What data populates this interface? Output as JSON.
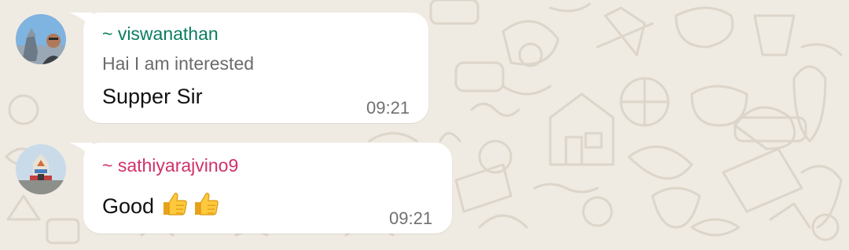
{
  "messages": [
    {
      "sender": "~ viswanathan",
      "sender_color": "#0a7d5f",
      "quoted_text": "Hai I am interested",
      "text": "Supper Sir",
      "time": "09:21"
    },
    {
      "sender": "~ sathiyarajvino9",
      "sender_color": "#d0306a",
      "text": "Good",
      "emojis": [
        "thumbs-up-icon",
        "thumbs-up-icon"
      ],
      "time": "09:21"
    }
  ],
  "colors": {
    "chat_background": "#efeae2",
    "bubble": "#ffffff",
    "timestamp": "#707070"
  }
}
